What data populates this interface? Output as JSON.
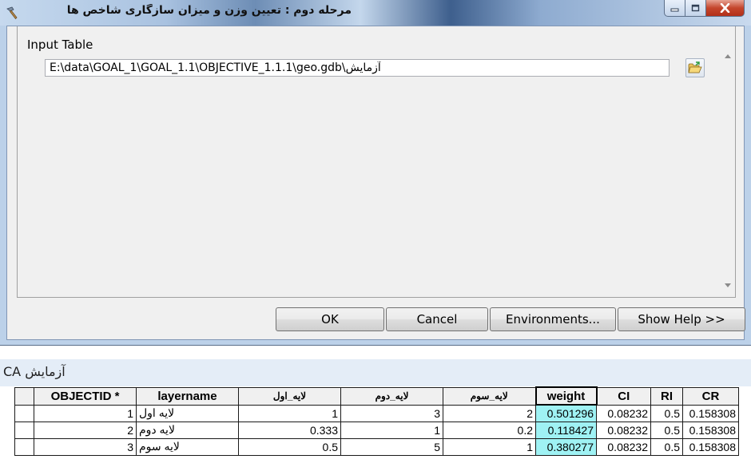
{
  "window": {
    "title": "مرحله دوم : تعیین وزن و میزان سازگاری شاخص ها",
    "icon": "hammer-tool-icon",
    "controls": [
      "minimize-icon",
      "maximize-icon",
      "close-icon"
    ]
  },
  "form": {
    "input_label": "Input Table",
    "input_value": "E:\\data\\GOAL_1\\GOAL_1.1\\OBJECTIVE_1.1.1\\geo.gdb\\آزمایش",
    "browse_icon": "open-folder-icon"
  },
  "buttons": {
    "ok": "OK",
    "cancel": "Cancel",
    "environments": "Environments...",
    "help": "Show Help >>"
  },
  "table": {
    "title": "آزمایش CA",
    "columns": [
      "OBJECTID *",
      "layername",
      "لایه_اول",
      "لایه_دوم",
      "لایه_سوم",
      "weight",
      "CI",
      "RI",
      "CR"
    ],
    "rows": [
      [
        "1",
        "لایه اول",
        "1",
        "3",
        "2",
        "0.501296",
        "0.08232",
        "0.5",
        "0.158308"
      ],
      [
        "2",
        "لایه دوم",
        "0.333",
        "1",
        "0.2",
        "0.118427",
        "0.08232",
        "0.5",
        "0.158308"
      ],
      [
        "3",
        "لایه سوم",
        "0.5",
        "5",
        "1",
        "0.380277",
        "0.08232",
        "0.5",
        "0.158308"
      ]
    ]
  },
  "colors": {
    "selected_column": "#9ff2f4",
    "close_button": "#c4452c"
  }
}
